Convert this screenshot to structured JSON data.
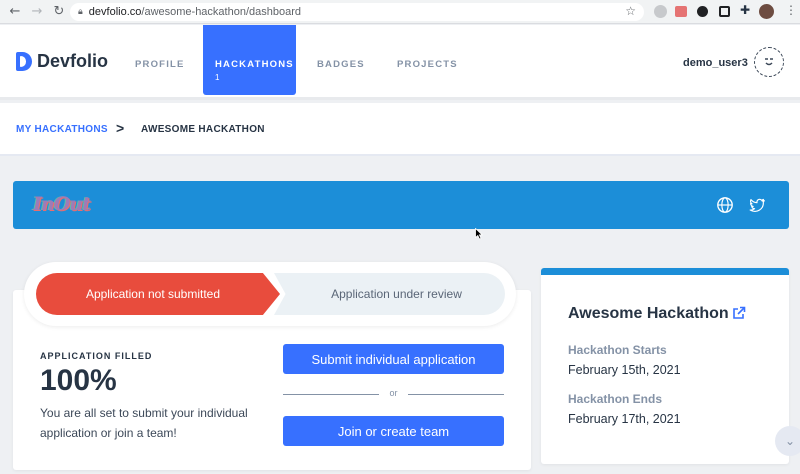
{
  "browser": {
    "url_host": "devfolio.co",
    "url_path": "/awesome-hackathon/dashboard",
    "icons": [
      "back-icon",
      "forward-icon",
      "reload-icon",
      "lock-icon",
      "star-icon",
      "extensions-icon",
      "menu-icon"
    ]
  },
  "header": {
    "logo_text": "Devfolio",
    "tabs": [
      {
        "label": "PROFILE",
        "active": false
      },
      {
        "label": "HACKATHONS",
        "count": "1",
        "active": true
      },
      {
        "label": "BADGES",
        "active": false
      },
      {
        "label": "PROJECTS",
        "active": false
      }
    ],
    "username": "demo_user3",
    "avatar_glyph": "ᵕ̈"
  },
  "breadcrumb": {
    "parent": "MY HACKATHONS",
    "separator": ">",
    "current": "AWESOME HACKATHON"
  },
  "banner": {
    "logo_text": "InOut",
    "color": "#1c8ed8",
    "icons": [
      "globe-icon",
      "twitter-icon"
    ]
  },
  "application": {
    "steps": [
      {
        "label": "Application not submitted",
        "state": "current",
        "color": "#e84c3d"
      },
      {
        "label": "Application under review",
        "state": "pending"
      }
    ],
    "filled_label": "APPLICATION FILLED",
    "filled_value": "100%",
    "description": "You are all set to submit your individual application or join a team!",
    "submit_button": "Submit individual application",
    "or_text": "or",
    "team_button": "Join or create team"
  },
  "hackathon": {
    "title": "Awesome Hackathon",
    "starts_label": "Hackathon Starts",
    "starts_value": "February 15th, 2021",
    "ends_label": "Hackathon Ends",
    "ends_value": "February 17th, 2021"
  },
  "colors": {
    "accent": "#3770ff",
    "banner": "#1c8ed8",
    "alert": "#e84c3d"
  }
}
